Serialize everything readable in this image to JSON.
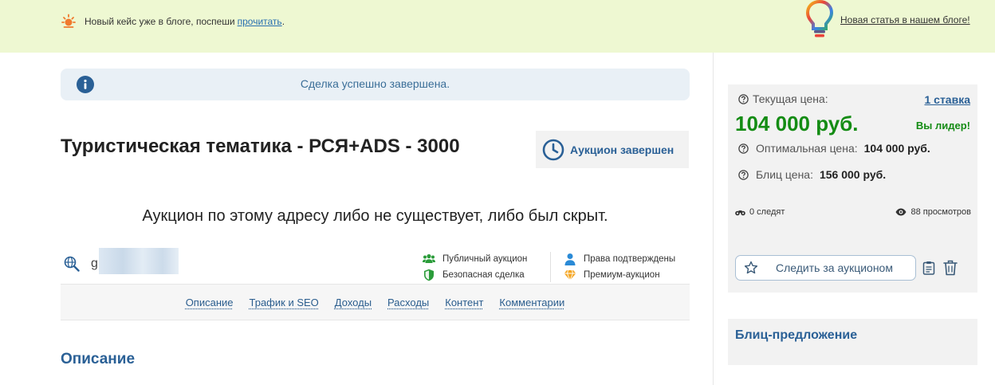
{
  "banner": {
    "left_text": "Новый кейс уже в блоге, поспеши",
    "left_link": "прочитать",
    "left_tail": ".",
    "right_link": "Новая статья в нашем блоге!"
  },
  "alert": {
    "text": "Сделка успешно завершена."
  },
  "lot": {
    "title": "Туристическая тематика - РСЯ+ADS - 3000",
    "status": "Аукцион завершен",
    "notice": "Аукцион по этому адресу либо не существует, либо был скрыт.",
    "domain_visible": "g"
  },
  "features": {
    "public": "Публичный аукцион",
    "safe": "Безопасная сделка",
    "rights": "Права подтверждены",
    "premium": "Премиум-аукцион"
  },
  "tabs": [
    "Описание",
    "Трафик и SEO",
    "Доходы",
    "Расходы",
    "Контент",
    "Комментарии"
  ],
  "section_title": "Описание",
  "price_panel": {
    "current_label": "Текущая цена:",
    "bids_link": "1 ставка",
    "current_price": "104 000 руб.",
    "leader": "Вы лидер!",
    "optimal_label": "Оптимальная цена:",
    "optimal_value": "104 000 руб.",
    "blitz_label": "Блиц цена:",
    "blitz_value": "156 000 руб.",
    "watchers": "0 следят",
    "views": "88 просмотров",
    "watch_button": "Следить за аукционом"
  },
  "blitz_offer": {
    "title": "Блиц-предложение"
  },
  "colors": {
    "accent": "#2a6096",
    "price_green": "#148c14",
    "banner_bg": "#eef8d2"
  }
}
